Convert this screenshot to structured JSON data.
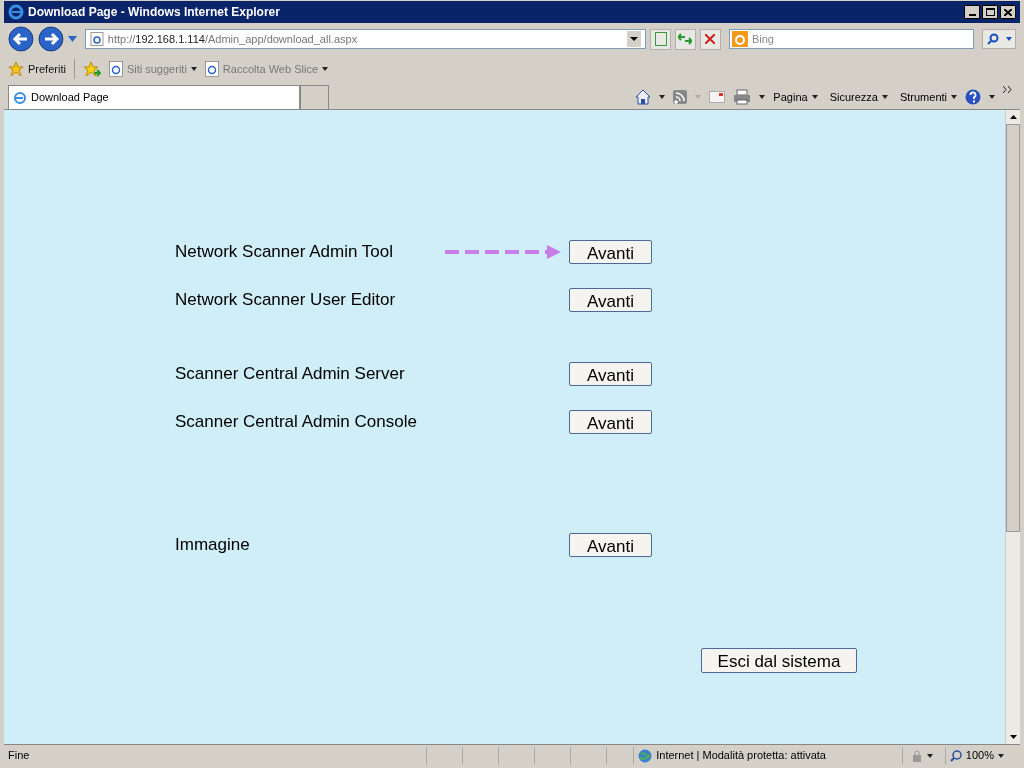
{
  "window": {
    "title": "Download Page - Windows Internet Explorer"
  },
  "address_bar": {
    "value": "http://**192.168.1.114**/Admin_app/download_all.aspx"
  },
  "search": {
    "placeholder": "Bing"
  },
  "favorites_bar": {
    "items": [
      {
        "label": "Preferiti",
        "kind": "star"
      },
      {
        "label": "Siti suggeriti",
        "kind": "link"
      },
      {
        "label": "Raccolta Web Slice",
        "kind": "link"
      }
    ]
  },
  "tabs": [
    {
      "label": "Download Page",
      "selected": true
    }
  ],
  "command_bar": {
    "menus": [
      "Pagina",
      "Sicurezza",
      "Strumenti"
    ]
  },
  "page": {
    "groups": [
      [
        {
          "label": "Network Scanner Admin Tool",
          "button": "Avanti",
          "pointer_arrow": true
        },
        {
          "label": "Network Scanner User Editor",
          "button": "Avanti",
          "pointer_arrow": false
        }
      ],
      [
        {
          "label": "Scanner Central Admin Server",
          "button": "Avanti",
          "pointer_arrow": false
        },
        {
          "label": "Scanner Central Admin Console",
          "button": "Avanti",
          "pointer_arrow": false
        }
      ],
      [
        {
          "label": "Immagine",
          "button": "Avanti",
          "pointer_arrow": false
        }
      ]
    ],
    "logout_button": "Esci dal sistema"
  },
  "status_bar": {
    "text": "Fine",
    "zone": "Internet | Modalità protetta: attivata",
    "zoom": "100%"
  }
}
